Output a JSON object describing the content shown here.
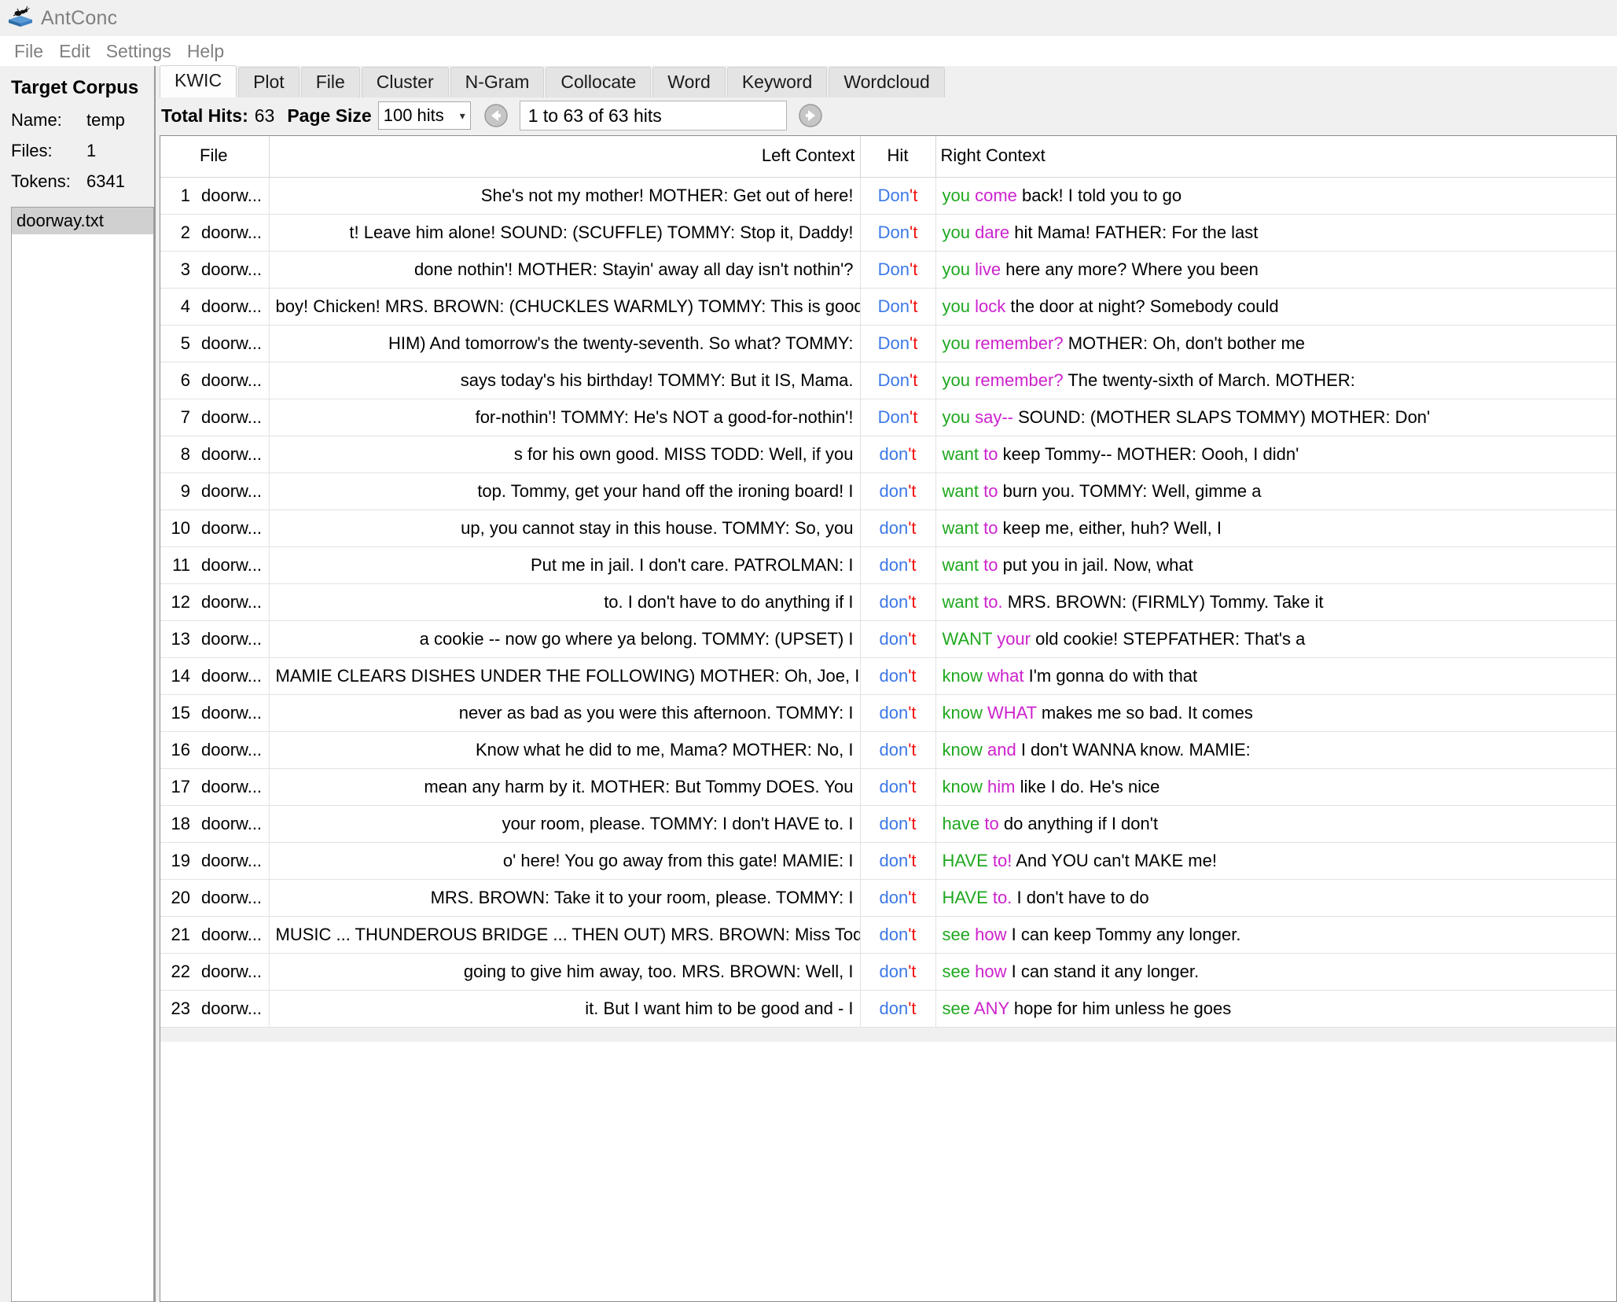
{
  "window": {
    "title": "AntConc",
    "icon": "ant-book-icon"
  },
  "menu": {
    "items": [
      "File",
      "Edit",
      "Settings",
      "Help"
    ]
  },
  "sidebar": {
    "heading": "Target Corpus",
    "fields": [
      {
        "label": "Name:",
        "value": "temp"
      },
      {
        "label": "Files:",
        "value": "1"
      },
      {
        "label": "Tokens:",
        "value": "6341"
      }
    ],
    "files": [
      "doorway.txt"
    ]
  },
  "tabs": [
    {
      "label": "KWIC",
      "active": true
    },
    {
      "label": "Plot",
      "active": false
    },
    {
      "label": "File",
      "active": false
    },
    {
      "label": "Cluster",
      "active": false
    },
    {
      "label": "N-Gram",
      "active": false
    },
    {
      "label": "Collocate",
      "active": false
    },
    {
      "label": "Word",
      "active": false
    },
    {
      "label": "Keyword",
      "active": false
    },
    {
      "label": "Wordcloud",
      "active": false
    }
  ],
  "toolbar": {
    "total_hits_label": "Total Hits:",
    "total_hits_value": "63",
    "page_size_label": "Page Size",
    "page_size_value": "100 hits",
    "page_size_options": [
      "100 hits"
    ],
    "prev_icon": "back-arrow-icon",
    "next_icon": "forward-arrow-icon",
    "range_text": "1 to 63 of 63 hits"
  },
  "table": {
    "columns": [
      "",
      "File",
      "Left Context",
      "Hit",
      "Right Context"
    ],
    "colors": {
      "hit_main": "#3b78e7",
      "hit_tail": "#f01010",
      "right_word1": "#1fa81f",
      "right_word2": "#cc22cc",
      "right_rest": "#000000"
    },
    "rows": [
      {
        "n": "1",
        "file": "doorw...",
        "left": "She's not my mother! MOTHER: Get out of here!",
        "hit_main": "Don",
        "hit_tail": "'t",
        "r1": "you",
        "r2": "come",
        "rest": "back! I told you to go"
      },
      {
        "n": "2",
        "file": "doorw...",
        "left": "t! Leave him alone! SOUND: (SCUFFLE) TOMMY: Stop it, Daddy!",
        "hit_main": "Don",
        "hit_tail": "'t",
        "r1": "you",
        "r2": "dare",
        "rest": "hit Mama! FATHER: For the last"
      },
      {
        "n": "3",
        "file": "doorw...",
        "left": "done nothin'! MOTHER: Stayin' away all day isn't nothin'?",
        "hit_main": "Don",
        "hit_tail": "'t",
        "r1": "you",
        "r2": "live",
        "rest": "here any more? Where you been"
      },
      {
        "n": "4",
        "file": "doorw...",
        "left": "boy! Chicken! MRS. BROWN: (CHUCKLES WARMLY) TOMMY: This is good!",
        "hit_main": "Don",
        "hit_tail": "'t",
        "r1": "you",
        "r2": "lock",
        "rest": "the door at night? Somebody could"
      },
      {
        "n": "5",
        "file": "doorw...",
        "left": "HIM) And tomorrow's the twenty-seventh. So what? TOMMY:",
        "hit_main": "Don",
        "hit_tail": "'t",
        "r1": "you",
        "r2": "remember?",
        "rest": "MOTHER: Oh, don't bother me"
      },
      {
        "n": "6",
        "file": "doorw...",
        "left": "says today's his birthday! TOMMY: But it IS, Mama.",
        "hit_main": "Don",
        "hit_tail": "'t",
        "r1": "you",
        "r2": "remember?",
        "rest": "The twenty-sixth of March. MOTHER:"
      },
      {
        "n": "7",
        "file": "doorw...",
        "left": "for-nothin'! TOMMY: He's NOT a good-for-nothin'!",
        "hit_main": "Don",
        "hit_tail": "'t",
        "r1": "you",
        "r2": "say--",
        "rest": "SOUND: (MOTHER SLAPS TOMMY) MOTHER: Don'"
      },
      {
        "n": "8",
        "file": "doorw...",
        "left": "s for his own good. MISS TODD: Well, if you",
        "hit_main": "don",
        "hit_tail": "'t",
        "r1": "want",
        "r2": "to",
        "rest": "keep Tommy-- MOTHER: Oooh, I didn'"
      },
      {
        "n": "9",
        "file": "doorw...",
        "left": "top. Tommy, get your hand off the ironing board! I",
        "hit_main": "don",
        "hit_tail": "'t",
        "r1": "want",
        "r2": "to",
        "rest": "burn you. TOMMY: Well, gimme a"
      },
      {
        "n": "10",
        "file": "doorw...",
        "left": "up, you cannot stay in this house. TOMMY: So, you",
        "hit_main": "don",
        "hit_tail": "'t",
        "r1": "want",
        "r2": "to",
        "rest": "keep me, either, huh? Well, I"
      },
      {
        "n": "11",
        "file": "doorw...",
        "left": "Put me in jail. I don't care. PATROLMAN: I",
        "hit_main": "don",
        "hit_tail": "'t",
        "r1": "want",
        "r2": "to",
        "rest": "put you in jail. Now, what"
      },
      {
        "n": "12",
        "file": "doorw...",
        "left": "to. I don't have to do anything if I",
        "hit_main": "don",
        "hit_tail": "'t",
        "r1": "want",
        "r2": "to.",
        "rest": "MRS. BROWN: (FIRMLY) Tommy. Take it"
      },
      {
        "n": "13",
        "file": "doorw...",
        "left": "a cookie -- now go where ya belong. TOMMY: (UPSET) I",
        "hit_main": "don",
        "hit_tail": "'t",
        "r1": "WANT",
        "r2": "your",
        "rest": "old cookie! STEPFATHER: That's a"
      },
      {
        "n": "14",
        "file": "doorw...",
        "left": "MAMIE CLEARS DISHES UNDER THE FOLLOWING) MOTHER: Oh, Joe, I",
        "hit_main": "don",
        "hit_tail": "'t",
        "r1": "know",
        "r2": "what",
        "rest": "I'm gonna do with that"
      },
      {
        "n": "15",
        "file": "doorw...",
        "left": "never as bad as you were this afternoon. TOMMY: I",
        "hit_main": "don",
        "hit_tail": "'t",
        "r1": "know",
        "r2": "WHAT",
        "rest": "makes me so bad. It comes"
      },
      {
        "n": "16",
        "file": "doorw...",
        "left": "Know what he did to me, Mama? MOTHER: No, I",
        "hit_main": "don",
        "hit_tail": "'t",
        "r1": "know",
        "r2": "and",
        "rest": "I don't WANNA know. MAMIE:"
      },
      {
        "n": "17",
        "file": "doorw...",
        "left": "mean any harm by it. MOTHER: But Tommy DOES. You",
        "hit_main": "don",
        "hit_tail": "'t",
        "r1": "know",
        "r2": "him",
        "rest": "like I do. He's nice"
      },
      {
        "n": "18",
        "file": "doorw...",
        "left": "your room, please. TOMMY: I don't HAVE to. I",
        "hit_main": "don",
        "hit_tail": "'t",
        "r1": "have",
        "r2": "to",
        "rest": "do anything if I don't"
      },
      {
        "n": "19",
        "file": "doorw...",
        "left": "o' here! You go away from this gate! MAMIE: I",
        "hit_main": "don",
        "hit_tail": "'t",
        "r1": "HAVE",
        "r2": "to!",
        "rest": "And YOU can't MAKE me!"
      },
      {
        "n": "20",
        "file": "doorw...",
        "left": "MRS. BROWN: Take it to your room, please. TOMMY: I",
        "hit_main": "don",
        "hit_tail": "'t",
        "r1": "HAVE",
        "r2": "to.",
        "rest": "I don't have to do"
      },
      {
        "n": "21",
        "file": "doorw...",
        "left": "MUSIC ... THUNDEROUS BRIDGE ... THEN OUT) MRS. BROWN: Miss Todd, I",
        "hit_main": "don",
        "hit_tail": "'t",
        "r1": "see",
        "r2": "how",
        "rest": "I can keep Tommy any longer."
      },
      {
        "n": "22",
        "file": "doorw...",
        "left": "going to give him away, too. MRS. BROWN: Well, I",
        "hit_main": "don",
        "hit_tail": "'t",
        "r1": "see",
        "r2": "how",
        "rest": "I can stand it any longer."
      },
      {
        "n": "23",
        "file": "doorw...",
        "left": "it. But I want him to be good and - I",
        "hit_main": "don",
        "hit_tail": "'t",
        "r1": "see",
        "r2": "ANY",
        "rest": "hope for him unless he goes"
      }
    ]
  }
}
